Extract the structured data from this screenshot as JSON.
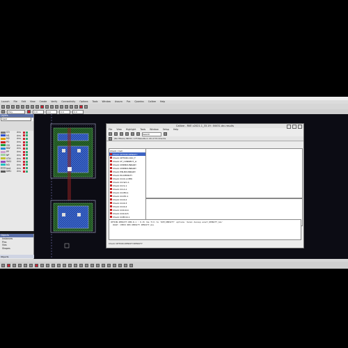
{
  "app": {
    "menu": [
      "Launch",
      "File",
      "Edit",
      "View",
      "Create",
      "Verify",
      "Connectivity",
      "Options",
      "Tools",
      "Window",
      "Assura",
      "Pvs",
      "Quantus",
      "Calibre",
      "Help"
    ],
    "toolbar2": {
      "layer_field": "Poly",
      "grid1": "0.0",
      "grid2": "0.0",
      "coord_x": "0.0",
      "coord_y": "0.0"
    }
  },
  "layers": {
    "title": "Layers",
    "filter": "Valid",
    "rows": [
      {
        "name": "CO",
        "purpose": "drw",
        "color": "#7a7a7a"
      },
      {
        "name": "M1",
        "purpose": "drw",
        "color": "#3050d0"
      },
      {
        "name": "M2",
        "purpose": "drw",
        "color": "#e0a000"
      },
      {
        "name": "PO",
        "purpose": "drw",
        "color": "#d02020"
      },
      {
        "name": "OD",
        "purpose": "drw",
        "color": "#20a040"
      },
      {
        "name": "NW",
        "purpose": "drw",
        "color": "#2b8ad8"
      },
      {
        "name": "PP",
        "purpose": "drw",
        "color": "#d0a0d0"
      },
      {
        "name": "NP",
        "purpose": "drw",
        "color": "#a0d0a0"
      },
      {
        "name": "VTH",
        "purpose": "drw",
        "color": "#c0c030"
      },
      {
        "name": "VIA1",
        "purpose": "drw",
        "color": "#9050c0"
      },
      {
        "name": "M3",
        "purpose": "drw",
        "color": "#20c0c0"
      },
      {
        "name": "text",
        "purpose": "drw",
        "color": "#e0e0e0"
      },
      {
        "name": "DM1",
        "purpose": "drw",
        "color": "#5a5a5a"
      }
    ]
  },
  "objects": {
    "title": "Objects",
    "rows": [
      "Instances",
      "Pins",
      "Vias",
      "Shapes"
    ]
  },
  "calibre": {
    "title": "Calibre - RVE v2021.1_33.19 : INV31.drc.results",
    "menu": [
      "File",
      "View",
      "Highlight",
      "Tools",
      "Window",
      "Setup",
      "Help"
    ],
    "search_placeholder": "Search",
    "info": "(No filters)   INV31: 173 Results in 29 of 70 Checks",
    "checks": [
      "Check / Cell",
      "Check OPTION.DENSITY",
      "Check OPTION.COO_T",
      "Check CF_CONNECT_LI",
      "Check CMP.BOUNDARY",
      "Check CMP.BOUNDARY",
      "Check PIN.BOUNDARY",
      "Check PO.DENSITY",
      "Check CO.R.1.DEN",
      "Check CO.W.1.1",
      "Check CO.S.1",
      "Check CO.A.1",
      "Check CO.EN.1",
      "Check CO.EX.1",
      "Check CO.R.2",
      "Check CO.R.3",
      "Check CO.R.4",
      "Check COO.R.4",
      "Check COO.R.5",
      "Check COEX.R.1"
    ],
    "description": "OPTION.DENSITY.DEN.R.1 : 0.15 rms fill to 'RIM_DENSITY' options 'densi decoup exact_DENSITY_ALL'\n  RULE: CHECK RED DENSITY DENSITY_ALL",
    "status": "Check OPTION.DENSITY.DENSITY"
  }
}
